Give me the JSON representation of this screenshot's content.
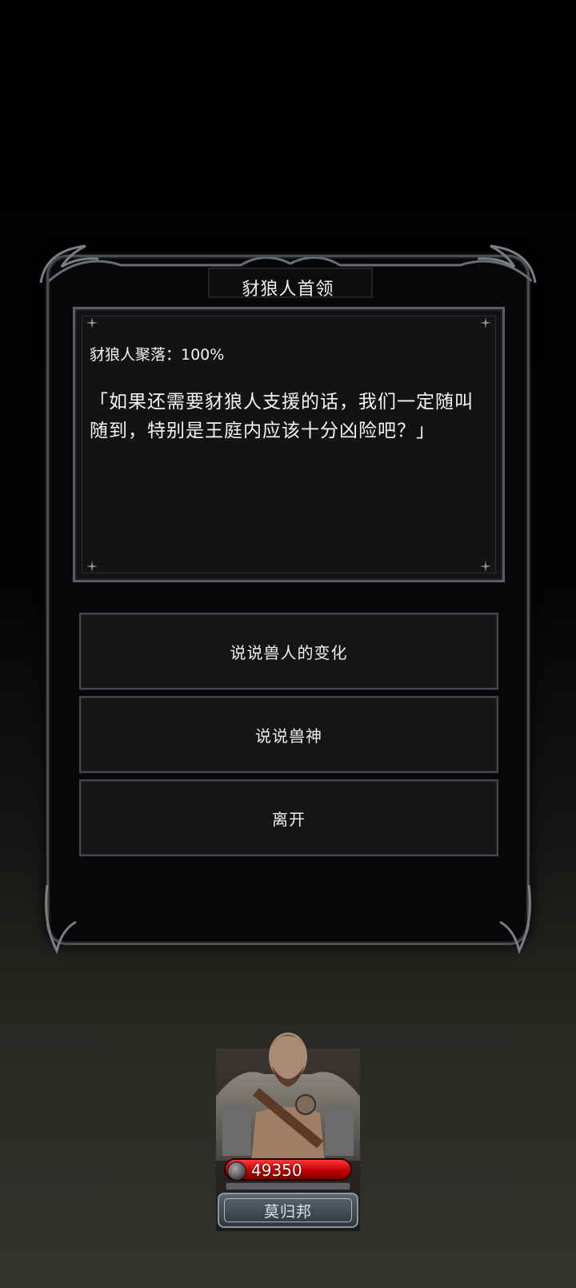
{
  "dialog": {
    "title": "豺狼人首领",
    "subtitle": "豺狼人聚落：100%",
    "body": "「如果还需要豺狼人支援的话，我们一定随叫随到，特别是王庭内应该十分凶险吧？」"
  },
  "choices": [
    {
      "label": "说说兽人的变化"
    },
    {
      "label": "说说兽神"
    },
    {
      "label": "离开"
    }
  ],
  "hero": {
    "power": "49350",
    "name": "莫归邦"
  },
  "colors": {
    "hp_red": "#c20000",
    "frame": "#4a4d52",
    "panel": "#121315"
  }
}
